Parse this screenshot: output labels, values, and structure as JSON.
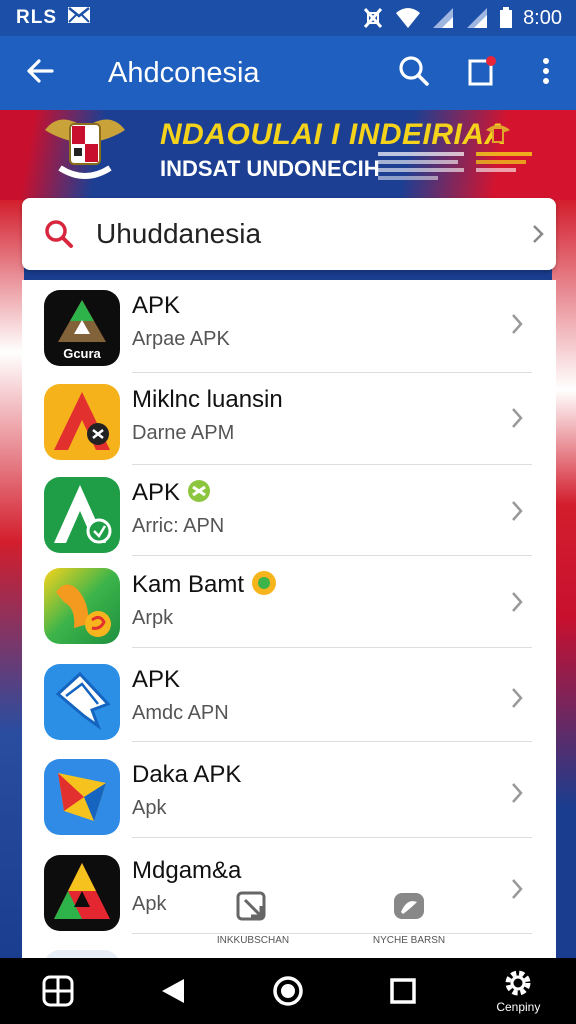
{
  "status_bar": {
    "carrier": "RLS",
    "time": "8:00"
  },
  "app_bar": {
    "title": "Ahdconesia"
  },
  "banner": {
    "line1": "NDAOULAI I INDEIRIAA",
    "line2": "INDSAT UNDONECIH"
  },
  "search": {
    "value": "Uhuddanesia"
  },
  "apps": [
    {
      "name": "APK",
      "sub": "Arpae APK",
      "icon_label": "Gcura"
    },
    {
      "name": "Miklnc luansin",
      "sub": "Darne APM",
      "icon_label": ""
    },
    {
      "name": "APK",
      "sub": "Arric: APN",
      "icon_label": ""
    },
    {
      "name": "Kam Bamt",
      "sub": "Arpk",
      "icon_label": ""
    },
    {
      "name": "APK",
      "sub": "Amdc APN",
      "icon_label": ""
    },
    {
      "name": "Daka APK",
      "sub": "Apk",
      "icon_label": ""
    },
    {
      "name": "Mdgam&a",
      "sub": "Apk",
      "icon_label": ""
    }
  ],
  "overlay_tabs": [
    {
      "label": "INKKUBSCHAN"
    },
    {
      "label": "NYCHE BARSN"
    }
  ],
  "nav": {
    "settings_label": "Cenpiny"
  },
  "colors": {
    "app_bar": "#1f5fbf",
    "status_bar": "#1b4fa8",
    "accent_red": "#d7263d",
    "banner_yellow": "#f5d31a"
  }
}
